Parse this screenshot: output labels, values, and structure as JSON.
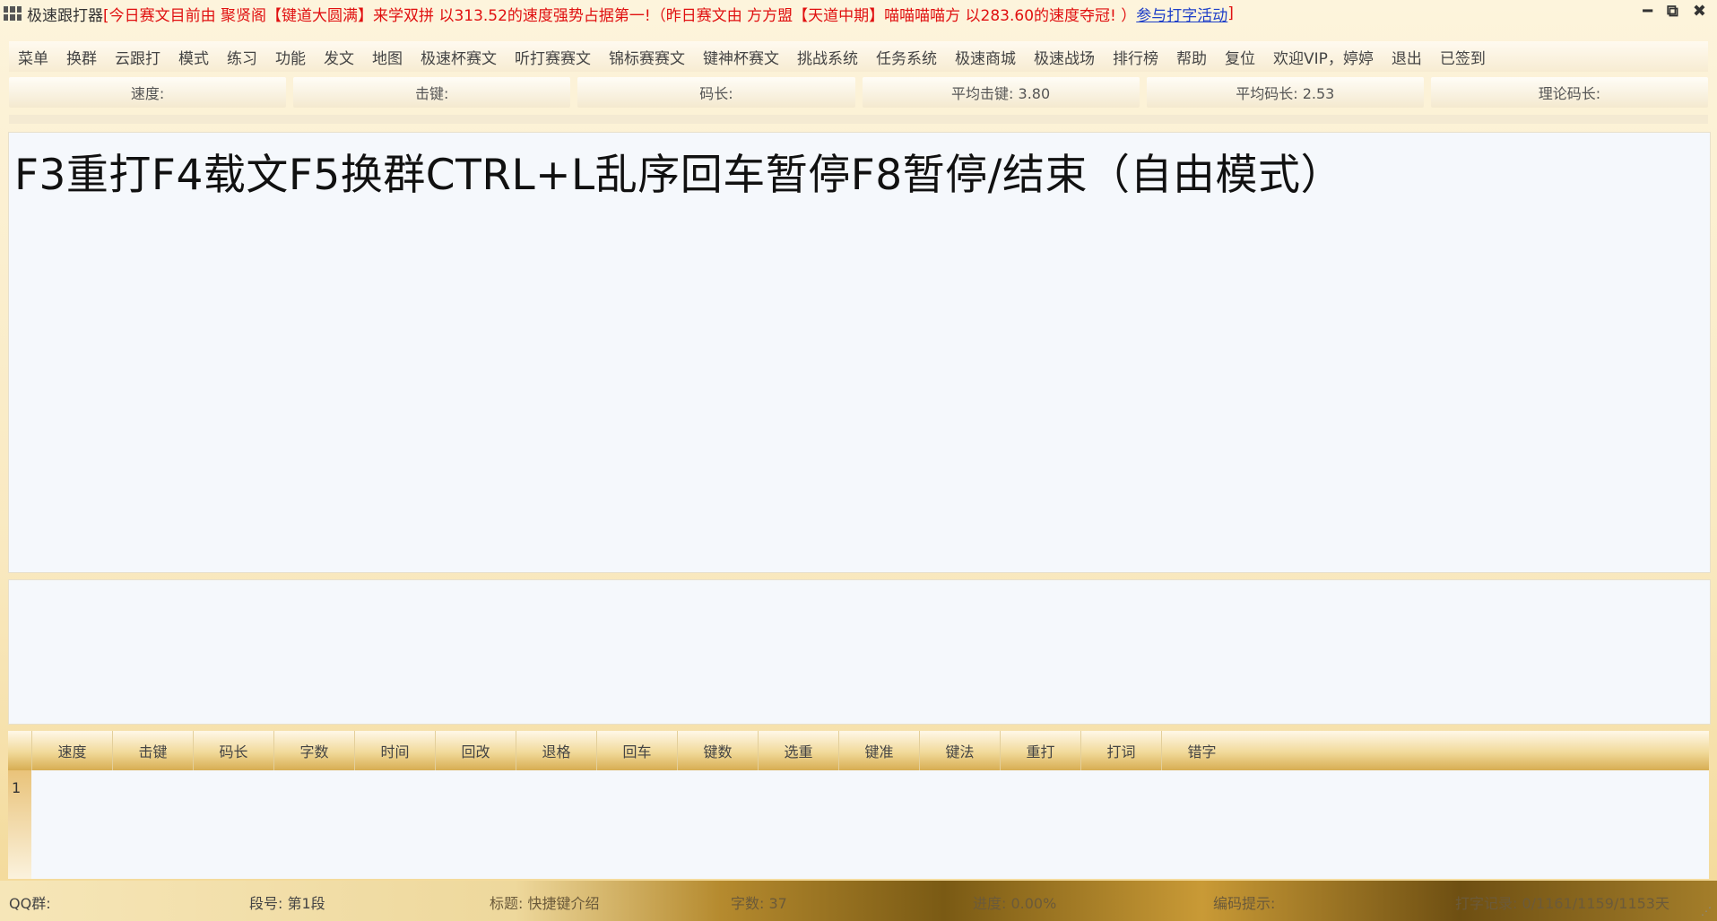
{
  "titlebar": {
    "app_name": "极速跟打器",
    "notice": "[今日赛文目前由 聚贤阁【键道大圆满】来学双拼 以313.52的速度强势占据第一!（昨日赛文由 方方盟【天道中期】喵喵喵喵方 以283.60的速度夺冠! ）",
    "link": "参与打字活动",
    "close_bracket": "]",
    "minimize": "━",
    "restore": "⧉",
    "close": "✖"
  },
  "menu": [
    "菜单",
    "换群",
    "云跟打",
    "模式",
    "练习",
    "功能",
    "发文",
    "地图",
    "极速杯赛文",
    "听打赛赛文",
    "锦标赛赛文",
    "键神杯赛文",
    "挑战系统",
    "任务系统",
    "极速商城",
    "极速战场",
    "排行榜",
    "帮助",
    "复位",
    "欢迎VIP，婷婷",
    "退出",
    "已签到"
  ],
  "stats": [
    "速度:",
    "击键:",
    "码长:",
    "平均击键: 3.80",
    "平均码长: 2.53",
    "理论码长:"
  ],
  "main_text": "F3重打F4载文F5换群CTRL+L乱序回车暂停F8暂停/结束（自由模式）",
  "table": {
    "headers": [
      "速度",
      "击键",
      "码长",
      "字数",
      "时间",
      "回改",
      "退格",
      "回车",
      "键数",
      "选重",
      "键准",
      "键法",
      "重打",
      "打词",
      "错字"
    ],
    "row_number": "1"
  },
  "status": {
    "qq": "QQ群:",
    "segment": "段号: 第1段",
    "title": "标题: 快捷键介绍",
    "count": "字数: 37",
    "progress": "进度: 0.00%",
    "hint": "编码提示:",
    "record": "打字记录: 0/1161/1159/1153天"
  }
}
